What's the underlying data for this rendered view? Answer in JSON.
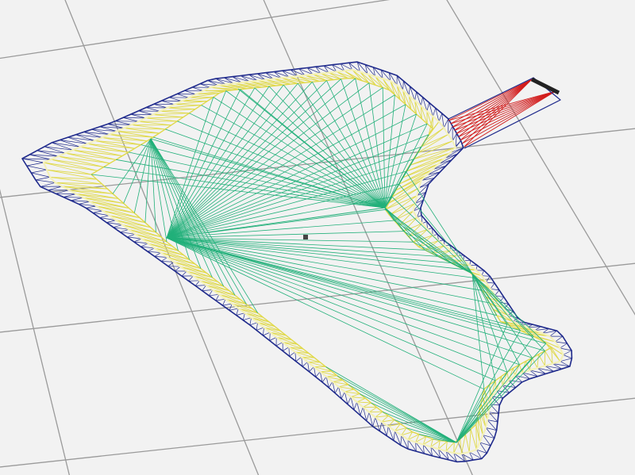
{
  "viewer": {
    "background": "#f2f2f2",
    "grid_color": "#9a9a9a"
  },
  "mesh": {
    "outer_band_color": "#1f2a8c",
    "inner_band_color": "#e0d94a",
    "band_highlight_color": "#f4f1b8",
    "interior_color": "#22b07a",
    "inlet_color": "#d21c1c",
    "inlet_cap_color": "#222222",
    "center_marker_color": "#444444"
  }
}
